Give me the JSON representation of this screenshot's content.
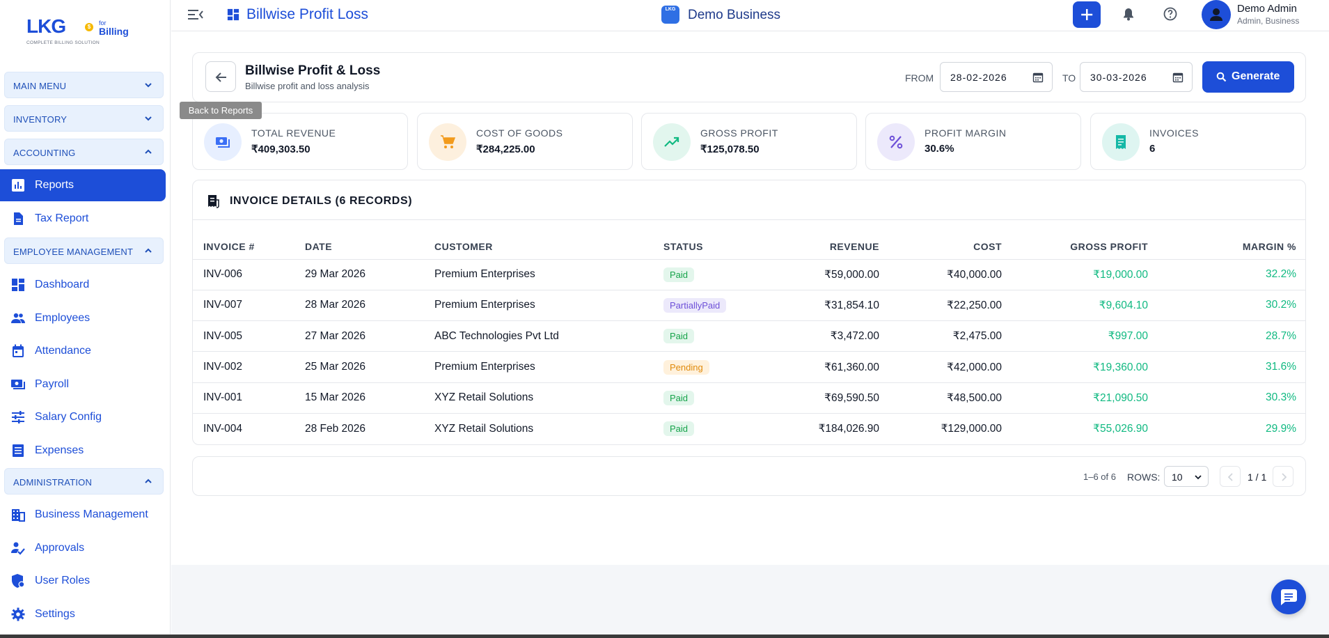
{
  "sidebar": {
    "logo": {
      "name": "LKG",
      "tagline": "COMPLETE BILLING SOLUTION",
      "for": "for",
      "product": "Billing"
    },
    "sections": {
      "main_menu": "MAIN MENU",
      "inventory": "INVENTORY",
      "accounting": "ACCOUNTING",
      "employee_management": "EMPLOYEE MANAGEMENT",
      "administration": "ADMINISTRATION"
    },
    "items": {
      "reports": "Reports",
      "tax_report": "Tax Report",
      "dashboard": "Dashboard",
      "employees": "Employees",
      "attendance": "Attendance",
      "payroll": "Payroll",
      "salary_config": "Salary Config",
      "expenses": "Expenses",
      "business_management": "Business Management",
      "approvals": "Approvals",
      "user_roles": "User Roles",
      "settings": "Settings"
    }
  },
  "header": {
    "page_title": "Billwise Profit Loss",
    "business_icon_text": "LKG",
    "business_name": "Demo Business",
    "user_name": "Demo Admin",
    "user_role": "Admin, Business"
  },
  "report": {
    "title": "Billwise Profit & Loss",
    "subtitle": "Billwise profit and loss analysis",
    "back_tooltip": "Back to Reports",
    "from_label": "FROM",
    "from_value": "28-02-2026",
    "to_label": "TO",
    "to_value": "30-03-2026",
    "generate_label": "Generate"
  },
  "stats": {
    "revenue": {
      "label": "TOTAL REVENUE",
      "value": "₹409,303.50"
    },
    "cogs": {
      "label": "COST OF GOODS",
      "value": "₹284,225.00"
    },
    "gross": {
      "label": "GROSS PROFIT",
      "value": "₹125,078.50"
    },
    "margin": {
      "label": "PROFIT MARGIN",
      "value": "30.6%"
    },
    "invoices": {
      "label": "INVOICES",
      "value": "6"
    }
  },
  "table": {
    "title": "INVOICE DETAILS (6 RECORDS)",
    "headers": {
      "invoice": "INVOICE #",
      "date": "DATE",
      "customer": "CUSTOMER",
      "status": "STATUS",
      "revenue": "REVENUE",
      "cost": "COST",
      "gross_profit": "GROSS PROFIT",
      "margin": "MARGIN %"
    },
    "rows": [
      {
        "invoice": "INV-006",
        "date": "29 Mar 2026",
        "customer": "Premium Enterprises",
        "status": "Paid",
        "revenue": "₹59,000.00",
        "cost": "₹40,000.00",
        "gross_profit": "₹19,000.00",
        "margin": "32.2%"
      },
      {
        "invoice": "INV-007",
        "date": "28 Mar 2026",
        "customer": "Premium Enterprises",
        "status": "PartiallyPaid",
        "revenue": "₹31,854.10",
        "cost": "₹22,250.00",
        "gross_profit": "₹9,604.10",
        "margin": "30.2%"
      },
      {
        "invoice": "INV-005",
        "date": "27 Mar 2026",
        "customer": "ABC Technologies Pvt Ltd",
        "status": "Paid",
        "revenue": "₹3,472.00",
        "cost": "₹2,475.00",
        "gross_profit": "₹997.00",
        "margin": "28.7%"
      },
      {
        "invoice": "INV-002",
        "date": "25 Mar 2026",
        "customer": "Premium Enterprises",
        "status": "Pending",
        "revenue": "₹61,360.00",
        "cost": "₹42,000.00",
        "gross_profit": "₹19,360.00",
        "margin": "31.6%"
      },
      {
        "invoice": "INV-001",
        "date": "15 Mar 2026",
        "customer": "XYZ Retail Solutions",
        "status": "Paid",
        "revenue": "₹69,590.50",
        "cost": "₹48,500.00",
        "gross_profit": "₹21,090.50",
        "margin": "30.3%"
      },
      {
        "invoice": "INV-004",
        "date": "28 Feb 2026",
        "customer": "XYZ Retail Solutions",
        "status": "Paid",
        "revenue": "₹184,026.90",
        "cost": "₹129,000.00",
        "gross_profit": "₹55,026.90",
        "margin": "29.9%"
      }
    ]
  },
  "pagination": {
    "info": "1–6 of 6",
    "rows_label": "ROWS:",
    "rows_value": "10",
    "page": "1 / 1"
  },
  "colors": {
    "primary": "#1d4ed8",
    "profit": "#10b981",
    "paid_badge": "#16a34a",
    "partial_badge": "#6d4fd8",
    "pending_badge": "#e08a0b"
  },
  "icons": {
    "menu": "menu-collapse-icon",
    "dashboard": "dashboard-grid-icon",
    "bell": "bell-icon",
    "help": "help-circle-icon",
    "user": "user-icon",
    "plus": "plus-icon",
    "back": "arrow-left-icon",
    "calendar": "calendar-icon",
    "search": "search-icon",
    "chat": "chat-icon"
  }
}
